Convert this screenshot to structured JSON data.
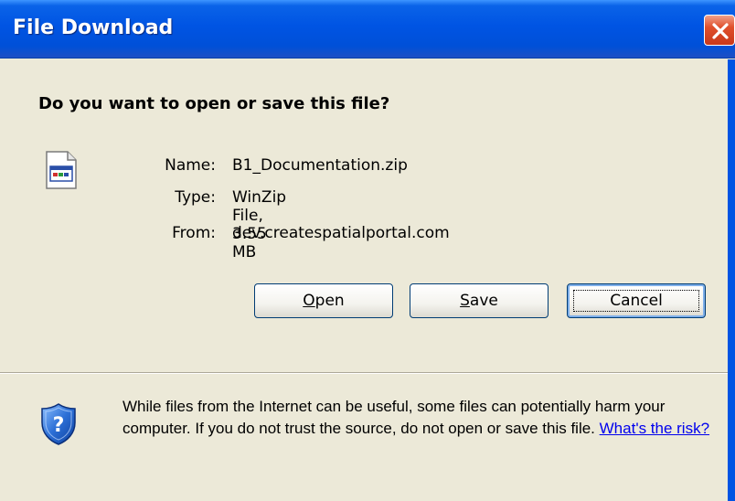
{
  "window": {
    "title": "File Download",
    "accent": "#0054e3",
    "close_color": "#e0502c"
  },
  "prompt": {
    "question": "Do you want to open or save this file?"
  },
  "file": {
    "icon": "zip-file-icon",
    "name_label": "Name:",
    "name_value": "B1_Documentation.zip",
    "type_label": "Type:",
    "type_value": "WinZip File, 3.55 MB",
    "from_label": "From:",
    "from_value": "dev.createspatialportal.com"
  },
  "buttons": {
    "open_mnemonic": "O",
    "open_rest": "pen",
    "save_mnemonic": "S",
    "save_rest": "ave",
    "cancel": "Cancel"
  },
  "warning": {
    "icon": "security-shield-icon",
    "text": "While files from the Internet can be useful, some files can potentially harm your computer. If you do not trust the source, do not open or save this file.",
    "link": "What's the risk?"
  }
}
